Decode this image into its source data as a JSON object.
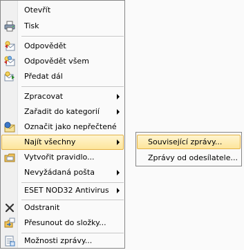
{
  "menu": {
    "items": [
      {
        "label": "Otevřít"
      },
      {
        "label": "Tisk",
        "icon": "printer-icon"
      },
      {
        "label": "Odpovědět",
        "icon": "reply-icon"
      },
      {
        "label": "Odpovědět všem",
        "icon": "reply-all-icon"
      },
      {
        "label": "Předat dál",
        "icon": "forward-icon"
      },
      {
        "label": "Zpracovat",
        "submenu": true
      },
      {
        "label": "Zařadit do kategorií",
        "submenu": true
      },
      {
        "label": "Označit jako nepřečtené",
        "icon": "mark-unread-icon"
      },
      {
        "label": "Najít všechny",
        "submenu": true,
        "state": "highlighted"
      },
      {
        "label": "Vytvořit pravidlo...",
        "icon": "create-rule-icon"
      },
      {
        "label": "Nevyžádaná pošta",
        "submenu": true
      },
      {
        "label": "ESET NOD32 Antivirus",
        "submenu": true
      },
      {
        "label": "Odstranit",
        "icon": "delete-icon"
      },
      {
        "label": "Přesunout do složky...",
        "icon": "move-to-folder-icon"
      },
      {
        "label": "Možnosti zprávy...",
        "icon": "message-options-icon"
      }
    ]
  },
  "submenu": {
    "items": [
      {
        "label": "Související zprávy...",
        "state": "highlighted"
      },
      {
        "label": "Zprávy od odesílatele..."
      }
    ]
  },
  "colors": {
    "highlight_border": "#e3b246",
    "highlight_fill": "#fde59b",
    "menu_border": "#868686"
  }
}
